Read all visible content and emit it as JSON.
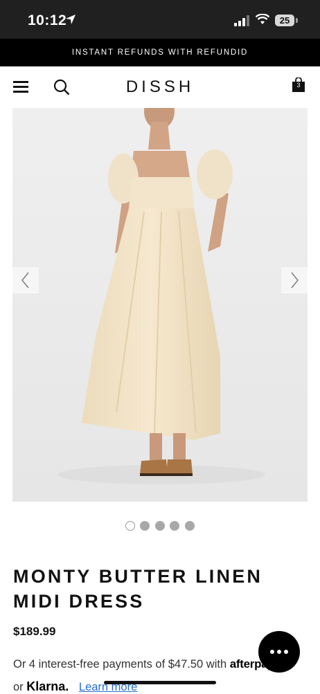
{
  "status_bar": {
    "time": "10:12",
    "battery": "25"
  },
  "announcement": {
    "text": "INSTANT REFUNDS WITH REFUNDID"
  },
  "header": {
    "logo": "DISSH",
    "bag_count": "3"
  },
  "carousel": {
    "slide_count": 5,
    "active_index": 0
  },
  "product": {
    "title": "MONTY BUTTER LINEN MIDI DRESS",
    "price": "$189.99",
    "afterpay_text": "Or 4 interest-free payments of $47.50 with",
    "afterpay_logo": "afterpay",
    "klarna_prefix": "or",
    "klarna_logo": "Klarna.",
    "learn_more": "Learn more"
  },
  "colors": {
    "accent_link": "#2a6ec9",
    "announcement_bg": "#000000",
    "dress": "#f1e2c4"
  }
}
